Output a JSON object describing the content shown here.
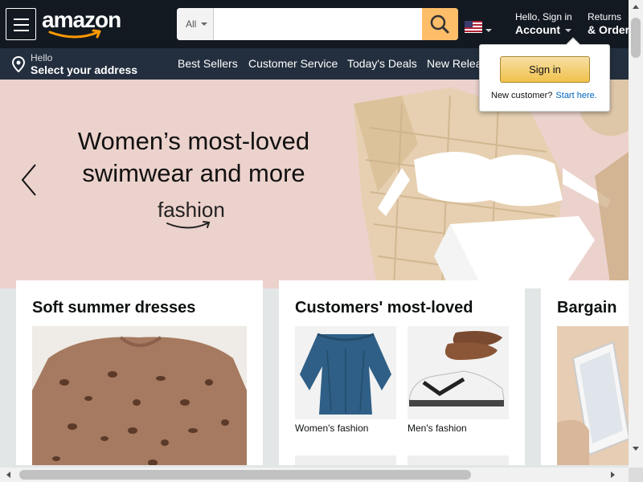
{
  "header": {
    "logo_text": "amazon",
    "search": {
      "category": "All",
      "placeholder": "",
      "value": ""
    },
    "account": {
      "line1": "Hello, Sign in",
      "line2": "Account"
    },
    "returns": {
      "line1": "Returns",
      "line2": "& Orders"
    }
  },
  "subnav": {
    "deliver": {
      "line1": "Hello",
      "line2": "Select your address"
    },
    "links": [
      "Best Sellers",
      "Customer Service",
      "Today's Deals",
      "New Releases"
    ]
  },
  "hero": {
    "title_line1": "Women’s most-loved",
    "title_line2": "swimwear and more",
    "brand": "fashion"
  },
  "cards": [
    {
      "title": "Soft summer dresses"
    },
    {
      "title": "Customers' most-loved",
      "tiles": [
        "Women's fashion",
        "Men's fashion"
      ]
    },
    {
      "title": "Bargain"
    }
  ],
  "signin_flyout": {
    "button_label": "Sign in",
    "new_customer": "New customer?",
    "start_here": "Start here."
  },
  "colors": {
    "nav_bg": "#131921",
    "subnav_bg": "#232f3e",
    "search_button": "#febd69",
    "signin_button": "#f0c14b",
    "logo_smile": "#ff9900",
    "link": "#0066c0",
    "hero_bg": "#ecd2cc"
  },
  "icons": [
    "menu-icon",
    "search-icon",
    "us-flag-icon",
    "location-pin-icon",
    "chevron-left-icon"
  ]
}
